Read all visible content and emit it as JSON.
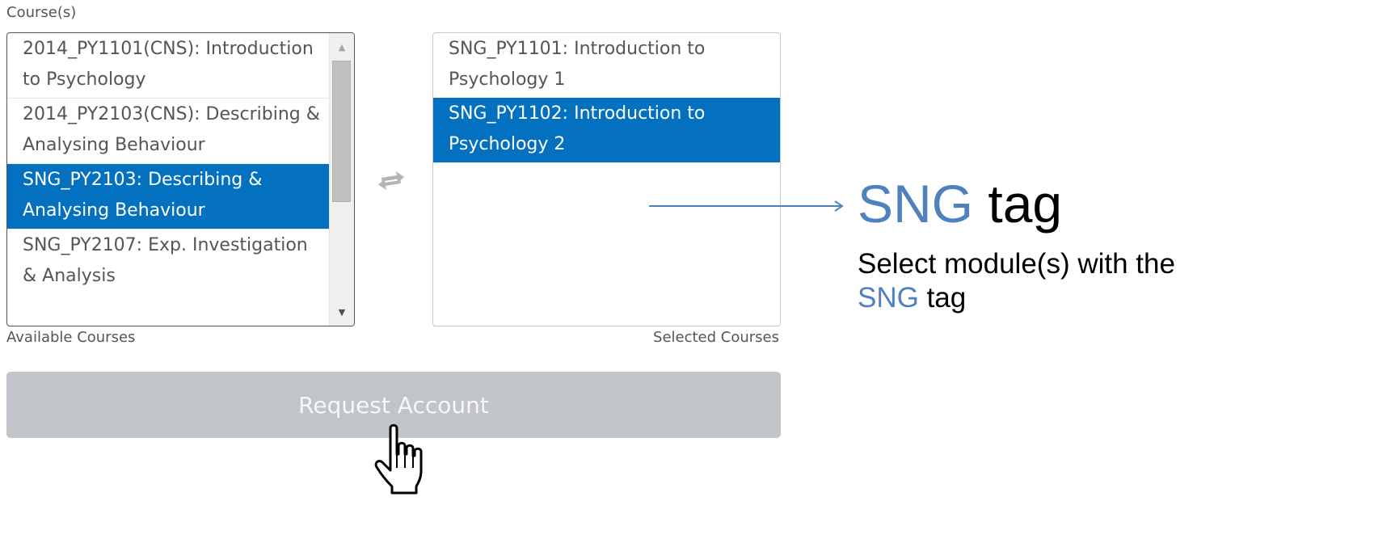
{
  "form": {
    "field_label": "Course(s)",
    "available": {
      "caption": "Available Courses",
      "items": [
        {
          "label": "2014_PY1101(CNS): Introduction to Psychology",
          "selected": false
        },
        {
          "label": "2014_PY2103(CNS): Describing & Analysing Behaviour",
          "selected": false
        },
        {
          "label": "SNG_PY2103: Describing & Analysing Behaviour",
          "selected": true
        },
        {
          "label": "SNG_PY2107: Exp. Investigation & Analysis",
          "selected": false
        }
      ]
    },
    "selected": {
      "caption": "Selected Courses",
      "items": [
        {
          "label": "SNG_PY1101: Introduction to Psychology 1",
          "selected": false
        },
        {
          "label": "SNG_PY1102: Introduction to Psychology 2",
          "selected": true
        }
      ]
    },
    "swap_icon": "swap-arrows-icon",
    "request_button": "Request Account"
  },
  "annotation": {
    "title_accent": "SNG",
    "title_rest": " tag",
    "desc_prefix": "Select module(s) with the ",
    "desc_accent": "SNG",
    "desc_suffix": " tag"
  },
  "colors": {
    "selection": "#0470c0",
    "accent": "#4f81bd",
    "button": "#c1c5c9"
  }
}
